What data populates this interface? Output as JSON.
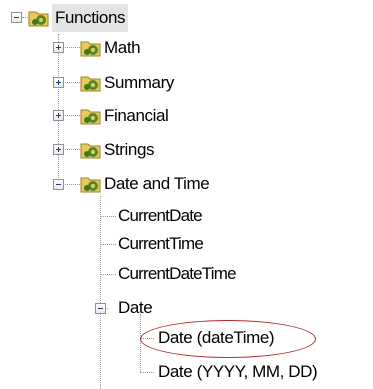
{
  "tree": {
    "root": {
      "label": "Functions",
      "expanded": true
    },
    "groups": [
      {
        "label": "Math",
        "expanded": false
      },
      {
        "label": "Summary",
        "expanded": false
      },
      {
        "label": "Financial",
        "expanded": false
      },
      {
        "label": "Strings",
        "expanded": false
      },
      {
        "label": "Date and Time",
        "expanded": true
      }
    ],
    "date_time_items": [
      "CurrentDate",
      "CurrentTime",
      "CurrentDateTime"
    ],
    "date_node": {
      "label": "Date",
      "expanded": true
    },
    "date_functions": [
      "Date (dateTime)",
      "Date (YYYY, MM, DD)"
    ]
  },
  "icons": {
    "folder_gear": "folder-gear-icon",
    "expand": "plus-box-icon",
    "collapse": "minus-box-icon"
  },
  "colors": {
    "highlight_ellipse": "#b22a2a",
    "tree_lines": "#9a9a9a"
  }
}
